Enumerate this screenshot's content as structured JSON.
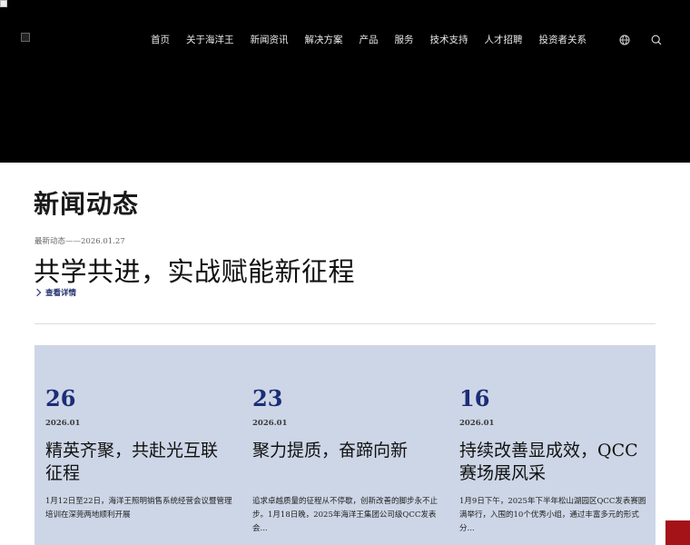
{
  "nav": {
    "items": [
      {
        "label": "首页"
      },
      {
        "label": "关于海洋王"
      },
      {
        "label": "新闻资讯"
      },
      {
        "label": "解决方案"
      },
      {
        "label": "产品"
      },
      {
        "label": "服务"
      },
      {
        "label": "技术支持"
      },
      {
        "label": "人才招聘"
      },
      {
        "label": "投资者关系"
      }
    ],
    "globe_icon": "globe-icon",
    "search_icon": "search-icon"
  },
  "main": {
    "page_title": "新闻动态",
    "latest": {
      "label": "最新动态——2026.01.27",
      "title": "共学共进，实战赋能新征程",
      "more": "查看详情"
    },
    "cards": [
      {
        "day": "26",
        "year_month": "2026.01",
        "title": "精英齐聚，共赴光互联征程",
        "summary": "1月12日至22日，海洋王照明销售系统经营会议暨管理培训在深莞两地顺利开展"
      },
      {
        "day": "23",
        "year_month": "2026.01",
        "title": "聚力提质，奋蹄向新",
        "summary": "追求卓越质量的征程从不停歇，创新改善的脚步永不止步。1月18日晚，2025年海洋王集团公司级QCC发表会..."
      },
      {
        "day": "16",
        "year_month": "2026.01",
        "title": "持续改善显成效，QCC赛场展风采",
        "summary": "1月9日下午，2025年下半年松山湖园区QCC发表赛圆满举行，入围的10个优秀小组，通过丰富多元的形式分..."
      }
    ]
  },
  "colors": {
    "hero_bg": "#000000",
    "accent_blue": "#1b2d77",
    "card_bg": "#cdd6e6",
    "float_red": "#a31318"
  }
}
